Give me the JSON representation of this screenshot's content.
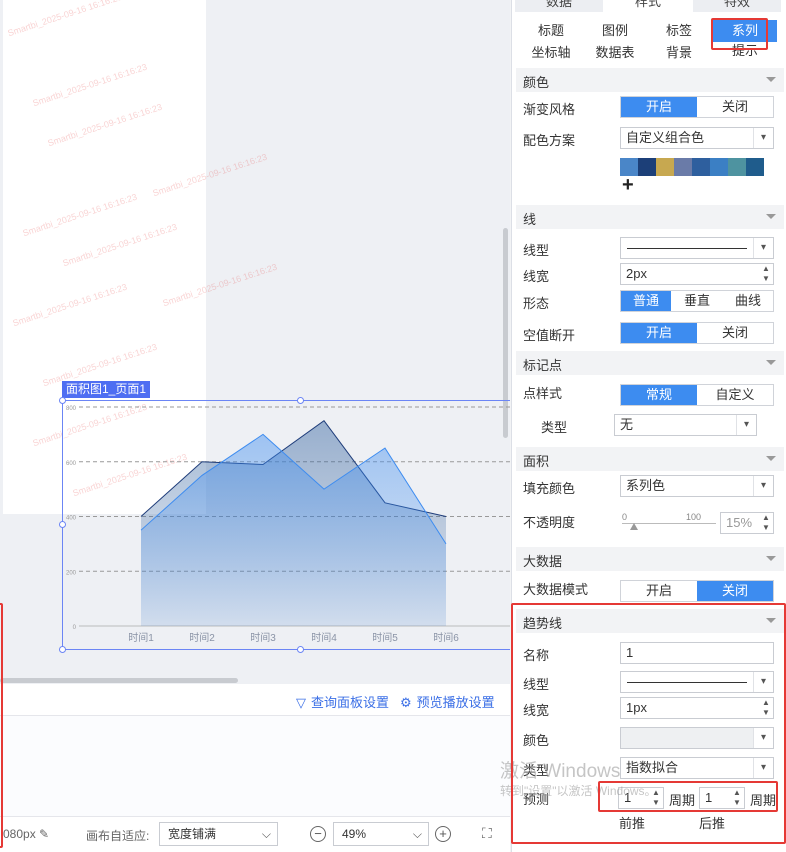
{
  "canvas": {
    "chart_label": "面积图1_页面1",
    "watermark_text": "Smartbi_2025-09-16 16:16:23"
  },
  "chart_data": {
    "type": "area",
    "categories": [
      "时间1",
      "时间2",
      "时间3",
      "时间4",
      "时间5",
      "时间6"
    ],
    "yticks": [
      "0",
      "200",
      "400",
      "600",
      "800"
    ],
    "ylim": [
      0,
      800
    ],
    "series": [
      {
        "values": [
          400,
          600,
          590,
          750,
          450,
          400
        ],
        "color": "#1f3d7a"
      },
      {
        "values": [
          350,
          550,
          700,
          500,
          650,
          300
        ],
        "color": "#3d8cf0"
      }
    ]
  },
  "query_bar": {
    "query_panel": "查询面板设置",
    "preview_settings": "预览播放设置"
  },
  "statusbar": {
    "width_text": "080px",
    "adapt_label": "画布自适应:",
    "adapt_value": "宽度铺满",
    "zoom_value": "49%"
  },
  "panel": {
    "top_tabs": [
      "数据",
      "样式",
      "特效"
    ],
    "sub_tabs": [
      "标题",
      "图例",
      "标签",
      "系列",
      "坐标轴",
      "数据表",
      "背景",
      "提示"
    ],
    "color_section": {
      "title": "颜色",
      "gradient_label": "渐变风格",
      "on": "开启",
      "off": "关闭",
      "scheme_label": "配色方案",
      "scheme_value": "自定义组合色",
      "swatch_colors": [
        "#4a86c8",
        "#1c3f78",
        "#c7a850",
        "#6a7ba8",
        "#2e5f9e",
        "#3b7fc4",
        "#4e93a0",
        "#1f5c8c"
      ]
    },
    "line_section": {
      "title": "线",
      "type_label": "线型",
      "width_label": "线宽",
      "width_value": "2px",
      "shape_label": "形态",
      "shape_options": [
        "普通",
        "垂直",
        "曲线"
      ],
      "null_break_label": "空值断开",
      "on": "开启",
      "off": "关闭"
    },
    "marker_section": {
      "title": "标记点",
      "style_label": "点样式",
      "style_options": [
        "常规",
        "自定义"
      ],
      "type_label": "类型",
      "type_value": "无"
    },
    "area_section": {
      "title": "面积",
      "fill_label": "填充颜色",
      "fill_value": "系列色",
      "opacity_label": "不透明度",
      "slider_min": "0",
      "slider_max": "100",
      "opacity_value": "15%"
    },
    "bigdata_section": {
      "title": "大数据",
      "mode_label": "大数据模式",
      "on": "开启",
      "off": "关闭"
    },
    "trend_section": {
      "title": "趋势线",
      "name_label": "名称",
      "name_value": "1",
      "type_label": "线型",
      "width_label": "线宽",
      "width_value": "1px",
      "color_label": "颜色",
      "kind_label": "类型",
      "kind_value": "指数拟合",
      "predict_label": "预测",
      "forward_value": "1",
      "backward_value": "1",
      "period": "周期",
      "forward_caption": "前推",
      "backward_caption": "后推"
    }
  },
  "windows_watermark": {
    "line1": "激活 Windows",
    "line2": "转到\"设置\"以激活 Windows。"
  }
}
